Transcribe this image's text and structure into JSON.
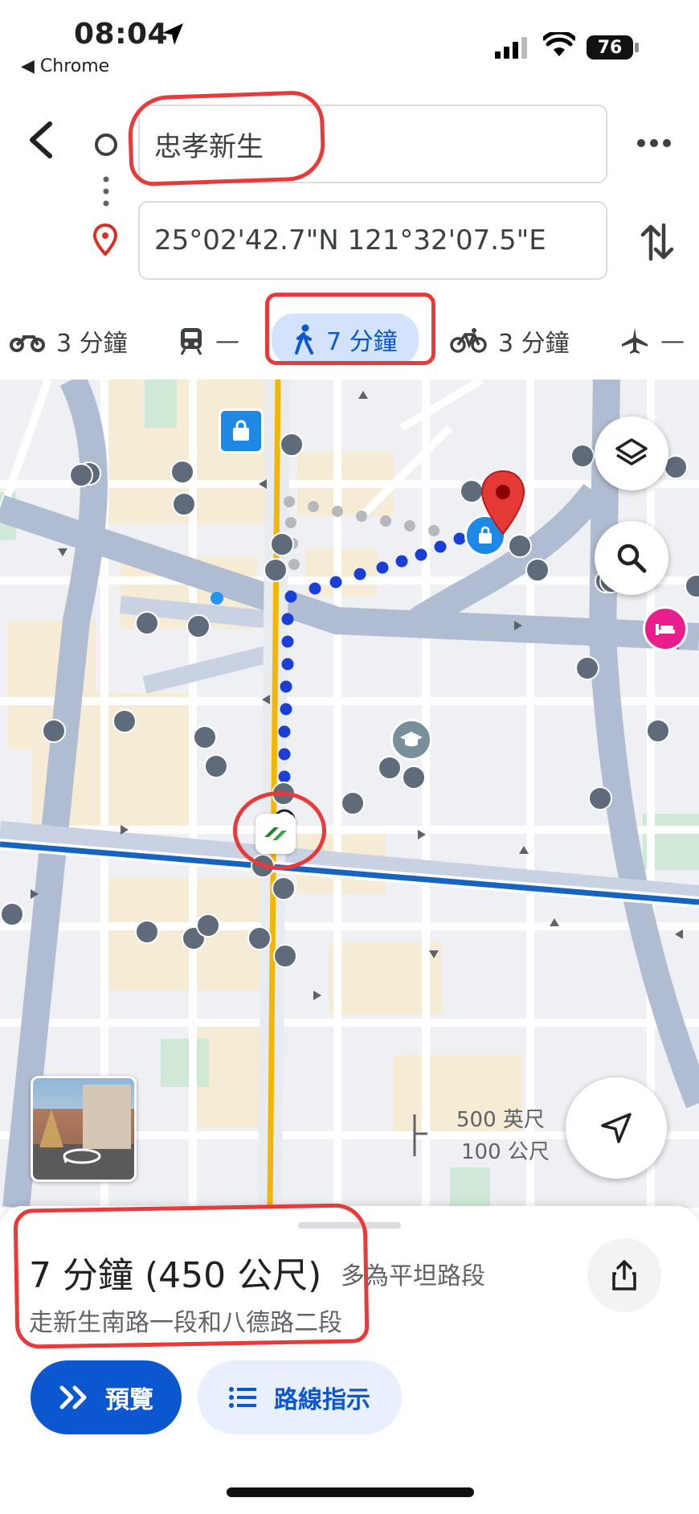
{
  "status_bar": {
    "time": "08:04",
    "back_app": "◀ Chrome",
    "battery": "76"
  },
  "route": {
    "from": "忠孝新生",
    "to": "25°02'42.7\"N 121°32'07.5\"E"
  },
  "modes": [
    {
      "name": "motorcycle",
      "label": "3 分鐘"
    },
    {
      "name": "transit",
      "label": "—"
    },
    {
      "name": "walk",
      "label": "7 分鐘",
      "selected": true
    },
    {
      "name": "bicycle",
      "label": "3 分鐘"
    },
    {
      "name": "flight",
      "label": "—"
    }
  ],
  "map": {
    "scale_imperial": "500 英尺",
    "scale_metric": "100 公尺"
  },
  "summary": {
    "duration": "7 分鐘 (450 公尺)",
    "terrain": "多為平坦路段",
    "via": "走新生南路一段和八德路二段"
  },
  "buttons": {
    "preview": "預覽",
    "steps": "路線指示"
  },
  "colors": {
    "accent": "#0b57d0",
    "route_dots": "#1a3fd6",
    "annotation": "#e83a3a",
    "destination_pin": "#e53935"
  }
}
